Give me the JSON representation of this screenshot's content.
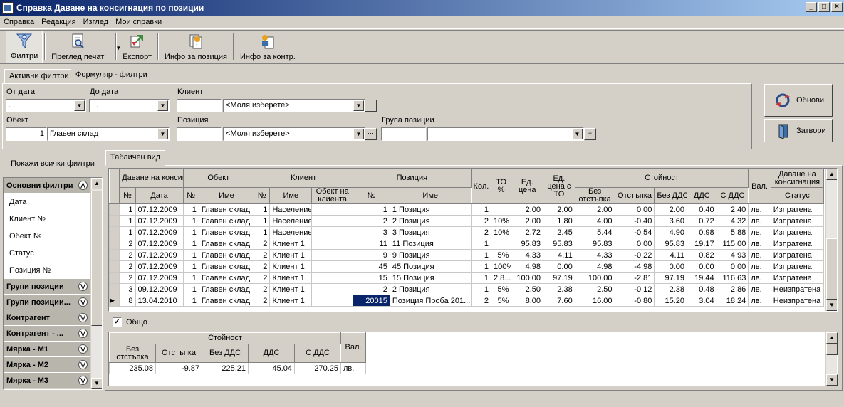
{
  "window": {
    "title": "Справка Даване на консигнация по позиции"
  },
  "menu": [
    "Справка",
    "Редакция",
    "Изглед",
    "Мои справки"
  ],
  "toolbar": {
    "filters": "Филтри",
    "print_preview": "Преглед печат",
    "export": "Експорт",
    "item_info": "Инфо за позиция",
    "contr_info": "Инфо за контр."
  },
  "tabs": {
    "active_filters": "Активни филтри",
    "form_filters": "Формуляр - филтри",
    "table_view": "Табличен вид"
  },
  "filters": {
    "from_date_label": "От дата",
    "from_date": " .  .",
    "to_date_label": "До дата",
    "to_date": " .  .",
    "client_label": "Клиент",
    "client_code": "",
    "client_value": "<Моля изберете>",
    "object_label": "Обект",
    "object_code": "1",
    "object_value": "Главен склад",
    "position_label": "Позиция",
    "position_code": "",
    "position_value": "<Моля изберете>",
    "group_label": "Група позиции",
    "group_code": "",
    "group_value": ""
  },
  "buttons": {
    "refresh": "Обнови",
    "close": "Затвори",
    "show_all_filters": "Покажи всички филтри"
  },
  "left_panel": {
    "basic": "Основни филтри",
    "basic_items": [
      "Дата",
      "Клиент №",
      "Обект №",
      "Статус",
      "Позиция №"
    ],
    "sections": [
      "Групи позиции",
      "Групи позиции...",
      "Контрагент",
      "Контрагент - ...",
      "Мярка - М1",
      "Мярка - М2",
      "Мярка - М3"
    ]
  },
  "grid": {
    "h_consign": "Даване на консигнация",
    "h_object": "Обект",
    "h_client": "Клиент",
    "h_position": "Позиция",
    "h_qty": "Кол.",
    "h_to": "ТО %",
    "h_unit_price": "Ед. цена",
    "h_unit_price_to": "Ед. цена с ТО",
    "h_value": "Стойност",
    "h_cur": "Вал.",
    "h_consign2": "Даване на консигнация",
    "s_no": "№",
    "s_date": "Дата",
    "s_obj_no": "№",
    "s_obj_name": "Име",
    "s_cl_no": "№",
    "s_cl_name": "Име",
    "s_cl_obj": "Обект на клиента",
    "s_pos_no": "№",
    "s_pos_name": "Име",
    "s_no_disc": "Без отстъпка",
    "s_disc": "Отстъпка",
    "s_no_vat": "Без ДДС",
    "s_vat": "ДДС",
    "s_with_vat": "С ДДС",
    "s_status": "Статус",
    "rows": [
      [
        "1",
        "07.12.2009",
        "1",
        "Главен склад",
        "1",
        "Население",
        "",
        "1",
        "1 Позиция",
        "1",
        "",
        "2.00",
        "2.00",
        "2.00",
        "0.00",
        "2.00",
        "0.40",
        "2.40",
        "лв.",
        "Изпратена"
      ],
      [
        "1",
        "07.12.2009",
        "1",
        "Главен склад",
        "1",
        "Население",
        "",
        "2",
        "2 Позиция",
        "2",
        "10%",
        "2.00",
        "1.80",
        "4.00",
        "-0.40",
        "3.60",
        "0.72",
        "4.32",
        "лв.",
        "Изпратена"
      ],
      [
        "1",
        "07.12.2009",
        "1",
        "Главен склад",
        "1",
        "Население",
        "",
        "3",
        "3 Позиция",
        "2",
        "10%",
        "2.72",
        "2.45",
        "5.44",
        "-0.54",
        "4.90",
        "0.98",
        "5.88",
        "лв.",
        "Изпратена"
      ],
      [
        "2",
        "07.12.2009",
        "1",
        "Главен склад",
        "2",
        "Клиент 1",
        "",
        "11",
        "11 Позиция",
        "1",
        "",
        "95.83",
        "95.83",
        "95.83",
        "0.00",
        "95.83",
        "19.17",
        "115.00",
        "лв.",
        "Изпратена"
      ],
      [
        "2",
        "07.12.2009",
        "1",
        "Главен склад",
        "2",
        "Клиент 1",
        "",
        "9",
        "9 Позиция",
        "1",
        "5%",
        "4.33",
        "4.11",
        "4.33",
        "-0.22",
        "4.11",
        "0.82",
        "4.93",
        "лв.",
        "Изпратена"
      ],
      [
        "2",
        "07.12.2009",
        "1",
        "Главен склад",
        "2",
        "Клиент 1",
        "",
        "45",
        "45 Позиция",
        "1",
        "100%",
        "4.98",
        "0.00",
        "4.98",
        "-4.98",
        "0.00",
        "0.00",
        "0.00",
        "лв.",
        "Изпратена"
      ],
      [
        "2",
        "07.12.2009",
        "1",
        "Главен склад",
        "2",
        "Клиент 1",
        "",
        "15",
        "15 Позиция",
        "1",
        "2.8...",
        "100.00",
        "97.19",
        "100.00",
        "-2.81",
        "97.19",
        "19.44",
        "116.63",
        "лв.",
        "Изпратена"
      ],
      [
        "3",
        "09.12.2009",
        "1",
        "Главен склад",
        "2",
        "Клиент 1",
        "",
        "2",
        "2 Позиция",
        "1",
        "5%",
        "2.50",
        "2.38",
        "2.50",
        "-0.12",
        "2.38",
        "0.48",
        "2.86",
        "лв.",
        "Неизпратена"
      ],
      [
        "8",
        "13.04.2010",
        "1",
        "Главен склад",
        "2",
        "Клиент 1",
        "",
        "20015",
        "Позиция Проба 201...",
        "2",
        "5%",
        "8.00",
        "7.60",
        "16.00",
        "-0.80",
        "15.20",
        "3.04",
        "18.24",
        "лв.",
        "Неизпратена"
      ]
    ]
  },
  "totals": {
    "checkbox_label": "Общо",
    "h_value": "Стойност",
    "h_cur": "Вал.",
    "h_no_disc": "Без отстъпка",
    "h_disc": "Отстъпка",
    "h_no_vat": "Без ДДС",
    "h_vat": "ДДС",
    "h_with_vat": "С ДДС",
    "no_disc": "235.08",
    "disc": "-9.87",
    "no_vat": "225.21",
    "vat": "45.04",
    "with_vat": "270.25",
    "cur": "лв."
  }
}
